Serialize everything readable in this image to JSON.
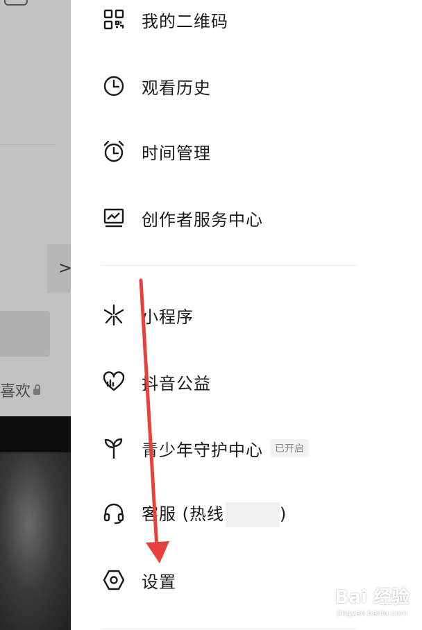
{
  "background": {
    "likes_label": "喜欢",
    "chevron": "›"
  },
  "menu": {
    "items": [
      {
        "label": "我的二维码",
        "icon": "qr-code-icon"
      },
      {
        "label": "观看历史",
        "icon": "clock-icon"
      },
      {
        "label": "时间管理",
        "icon": "alarm-clock-icon"
      },
      {
        "label": "创作者服务中心",
        "icon": "creator-chart-icon"
      },
      {
        "label": "小程序",
        "icon": "mini-program-icon"
      },
      {
        "label": "抖音公益",
        "icon": "heart-charity-icon"
      },
      {
        "label": "青少年守护中心",
        "icon": "sprout-icon",
        "badge": "已开启"
      },
      {
        "label": "客服 (热线",
        "label_tail": ")",
        "icon": "headset-icon"
      },
      {
        "label": "设置",
        "icon": "settings-hexagon-icon"
      }
    ]
  },
  "watermark": {
    "brand": "Bai 经验",
    "url": "jingyan.baidu.com"
  },
  "colors": {
    "arrow": "#e8413b",
    "text": "#1a1a1a",
    "badge_bg": "#f2f2f2"
  }
}
